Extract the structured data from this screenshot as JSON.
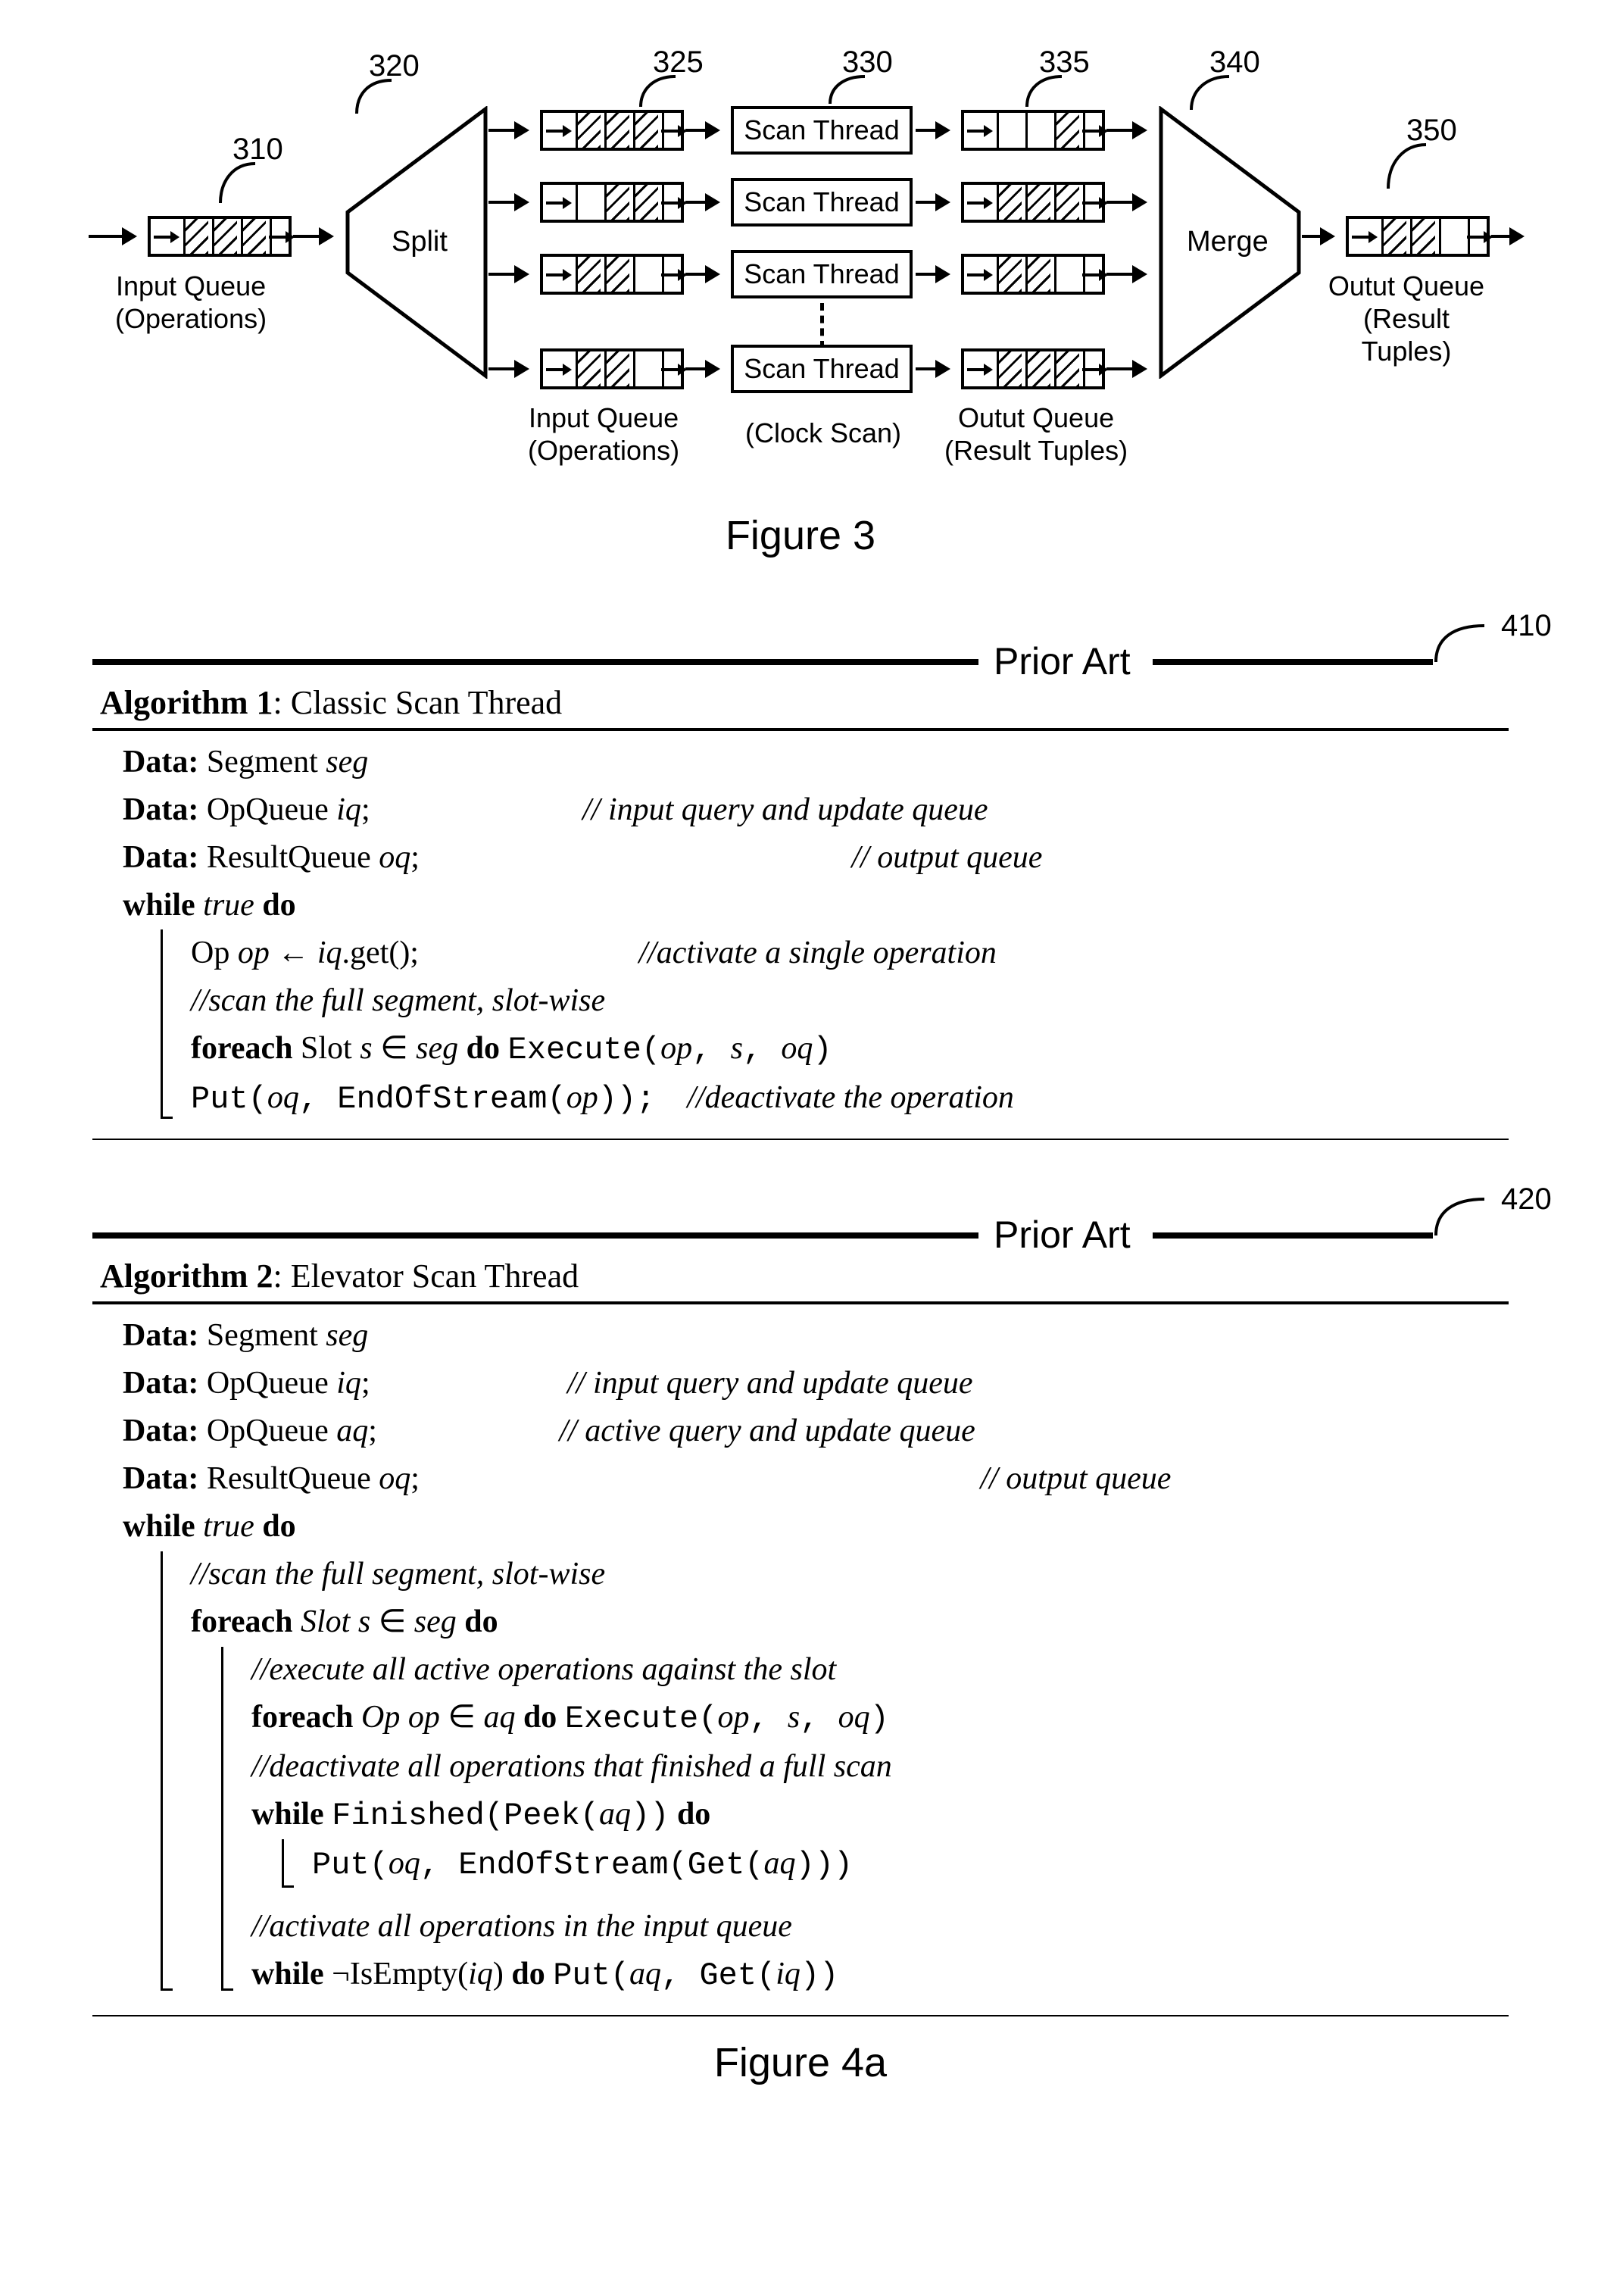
{
  "fig3": {
    "refs": {
      "input": "310",
      "split": "320",
      "inq": "325",
      "scan": "330",
      "outq": "335",
      "merge": "340",
      "output": "350"
    },
    "split": "Split",
    "merge": "Merge",
    "scan_thread": "Scan Thread",
    "input_label_l1": "Input Queue",
    "input_label_l2": "(Operations)",
    "output_label_l1": "Outut Queue",
    "output_label_l2": "(Result Tuples)",
    "mid_l1_in": "Input Queue",
    "mid_l2_in": "(Operations)",
    "mid_center": "(Clock Scan)",
    "mid_l1_out": "Outut Queue",
    "mid_l2_out": "(Result Tuples)",
    "caption": "Figure 3"
  },
  "alg1": {
    "ref": "410",
    "prior": "Prior Art",
    "title_label": "Algorithm 1",
    "title_name": ": Classic Scan Thread",
    "lines": {
      "d1a": "Data:",
      "d1b": " Segment ",
      "d1c": "seg",
      "d2a": "Data:",
      "d2b": " OpQueue ",
      "d2c": "iq",
      "d2d": ";",
      "d2e": "// input query and update queue",
      "d3a": "Data:",
      "d3b": " ResultQueue ",
      "d3c": "oq",
      "d3d": ";",
      "d3e": "// output queue",
      "w1a": "while ",
      "w1b": "true",
      "w1c": " do",
      "l1a": "Op ",
      "l1b": "op",
      "l1c": " ← ",
      "l1d": "iq",
      "l1e": ".get();",
      "l1f": "//activate a single operation",
      "c1": "//scan the full segment, slot-wise",
      "f1a": "foreach ",
      "f1b": "Slot ",
      "f1c": "s",
      "f1d": " ∈ ",
      "f1e": "seg",
      "f1f": " do  ",
      "f1g": "Execute(",
      "f1h": "op",
      "f1i": ", ",
      "f1j": "s",
      "f1k": ", ",
      "f1l": "oq",
      "f1m": ")",
      "p1a": "Put(",
      "p1b": "oq",
      "p1c": ", EndOfStream(",
      "p1d": "op",
      "p1e": "));",
      "p1f": "//deactivate the operation"
    }
  },
  "alg2": {
    "ref": "420",
    "prior": "Prior Art",
    "title_label": "Algorithm 2",
    "title_name": ": Elevator Scan Thread",
    "lines": {
      "d1a": "Data:",
      "d1b": " Segment ",
      "d1c": "seg",
      "d2a": "Data:",
      "d2b": " OpQueue ",
      "d2c": "iq",
      "d2d": ";",
      "d2e": "// input query and update queue",
      "d3a": "Data:",
      "d3b": " OpQueue ",
      "d3c": "aq",
      "d3d": ";",
      "d3e": "// active query and update queue",
      "d4a": "Data:",
      "d4b": " ResultQueue ",
      "d4c": "oq",
      "d4d": ";",
      "d4e": "// output queue",
      "w1a": "while ",
      "w1b": "true",
      "w1c": " do",
      "c1": "//scan the full segment, slot-wise",
      "f1a": "foreach ",
      "f1b": "Slot s",
      "f1c": " ∈ ",
      "f1d": "seg",
      "f1e": " do",
      "c2": "//execute all active operations against the slot",
      "f2a": "foreach ",
      "f2b": "Op op",
      "f2c": " ∈ ",
      "f2d": "aq",
      "f2e": " do  ",
      "f2f": "Execute(",
      "f2g": "op",
      "f2h": ", ",
      "f2i": "s",
      "f2j": ", ",
      "f2k": "oq",
      "f2l": ")",
      "c3": "//deactivate all operations that finished a full scan",
      "w2a": "while ",
      "w2b": "Finished(Peek(",
      "w2c": "aq",
      "w2d": "))",
      "w2e": " do",
      "p1a": "Put(",
      "p1b": "oq",
      "p1c": ", EndOfStream(Get(",
      "p1d": "aq",
      "p1e": ")))",
      "c4": "//activate all operations in the input queue",
      "w3a": "while ",
      "w3b": "¬IsEmpty(",
      "w3c": "iq",
      "w3d": ")",
      "w3e": " do  ",
      "w3f": "Put(",
      "w3g": "aq",
      "w3h": ", Get(",
      "w3i": "iq",
      "w3j": "))"
    }
  },
  "fig4_caption": "Figure 4a"
}
